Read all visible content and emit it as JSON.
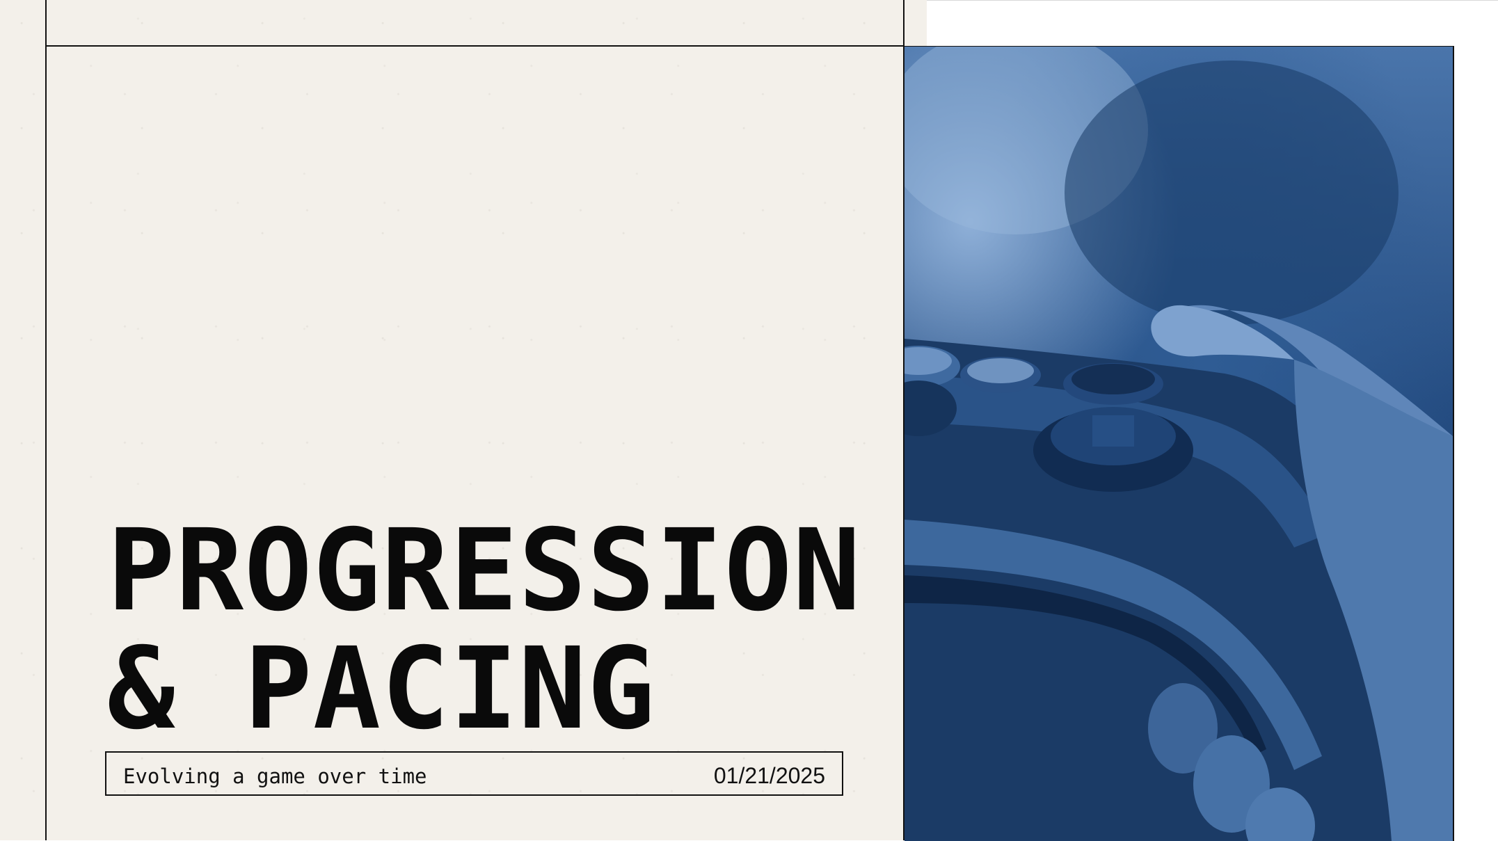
{
  "slide": {
    "title_line1": "PROGRESSION",
    "title_line2": "& PACING",
    "subtitle": "Evolving a game over time",
    "date": "01/21/2025"
  },
  "photo": {
    "tint_color": "#2f5c94"
  }
}
